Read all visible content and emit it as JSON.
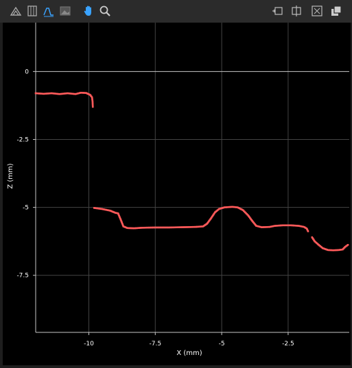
{
  "toolbar": {
    "icons": [
      "profile-3d-icon",
      "column-view-icon",
      "line-profile-icon",
      "image-view-icon",
      "pan-hand-icon",
      "zoom-icon",
      "fit-width-icon",
      "fit-height-icon",
      "fit-all-icon",
      "duplicate-window-icon"
    ],
    "active_view": "line-profile-icon",
    "active_tool": "pan-hand-icon"
  },
  "colors": {
    "background": "#000000",
    "grid": "#444444",
    "zero_line": "#c8c8c8",
    "series": "#ff5a5a",
    "toolbar_active": "#3aa3ff"
  },
  "chart_data": {
    "type": "scatter",
    "title": "",
    "xlabel": "X (mm)",
    "ylabel": "Z (mm)",
    "xlim": [
      -12.0,
      -0.2
    ],
    "ylim": [
      -9.6,
      1.8
    ],
    "xticks": [
      -10,
      -7.5,
      -5,
      -2.5
    ],
    "xtick_labels": [
      "-10",
      "-7.5",
      "-5",
      "-2.5"
    ],
    "yticks": [
      0,
      -2.5,
      -5,
      -7.5
    ],
    "ytick_labels": [
      "0",
      "-2.5",
      "-5",
      "-7.5"
    ],
    "grid": true,
    "legend": "none",
    "series": [
      {
        "segments": [
          [
            [
              -12.0,
              -0.8
            ],
            [
              -11.7,
              -0.82
            ],
            [
              -11.4,
              -0.8
            ],
            [
              -11.1,
              -0.83
            ],
            [
              -10.8,
              -0.8
            ],
            [
              -10.5,
              -0.83
            ],
            [
              -10.3,
              -0.78
            ],
            [
              -10.1,
              -0.79
            ],
            [
              -9.95,
              -0.86
            ],
            [
              -9.88,
              -0.95
            ],
            [
              -9.86,
              -1.1
            ],
            [
              -9.85,
              -1.3
            ]
          ],
          [
            [
              -9.8,
              -5.02
            ],
            [
              -9.5,
              -5.06
            ],
            [
              -9.2,
              -5.12
            ],
            [
              -9.0,
              -5.2
            ],
            [
              -8.9,
              -5.22
            ],
            [
              -8.8,
              -5.45
            ],
            [
              -8.7,
              -5.7
            ],
            [
              -8.55,
              -5.76
            ],
            [
              -8.3,
              -5.77
            ],
            [
              -8.0,
              -5.75
            ],
            [
              -7.5,
              -5.74
            ],
            [
              -7.0,
              -5.74
            ],
            [
              -6.5,
              -5.73
            ],
            [
              -6.0,
              -5.72
            ],
            [
              -5.7,
              -5.7
            ],
            [
              -5.55,
              -5.6
            ],
            [
              -5.4,
              -5.4
            ],
            [
              -5.25,
              -5.18
            ],
            [
              -5.1,
              -5.06
            ],
            [
              -4.9,
              -5.0
            ],
            [
              -4.6,
              -4.98
            ],
            [
              -4.4,
              -5.0
            ],
            [
              -4.2,
              -5.1
            ],
            [
              -4.0,
              -5.3
            ],
            [
              -3.85,
              -5.5
            ],
            [
              -3.7,
              -5.68
            ],
            [
              -3.5,
              -5.73
            ],
            [
              -3.2,
              -5.72
            ],
            [
              -3.0,
              -5.68
            ],
            [
              -2.7,
              -5.66
            ],
            [
              -2.4,
              -5.66
            ],
            [
              -2.1,
              -5.68
            ],
            [
              -1.9,
              -5.72
            ],
            [
              -1.8,
              -5.78
            ],
            [
              -1.75,
              -5.88
            ]
          ],
          [
            [
              -1.6,
              -6.1
            ],
            [
              -1.5,
              -6.25
            ],
            [
              -1.35,
              -6.38
            ],
            [
              -1.2,
              -6.5
            ],
            [
              -1.0,
              -6.57
            ],
            [
              -0.8,
              -6.58
            ],
            [
              -0.6,
              -6.57
            ],
            [
              -0.45,
              -6.55
            ],
            [
              -0.35,
              -6.45
            ],
            [
              -0.25,
              -6.38
            ]
          ]
        ]
      }
    ]
  }
}
